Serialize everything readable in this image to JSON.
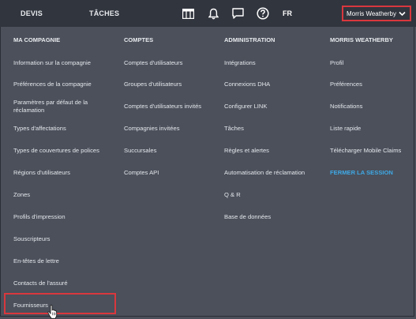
{
  "topbar": {
    "tabs": [
      "DEVIS",
      "TÂCHES"
    ],
    "icons": [
      "grid-icon",
      "bell-icon",
      "chat-icon",
      "help-icon",
      "chevron-down-icon"
    ],
    "language": "FR",
    "user_name": "Morris Weatherby"
  },
  "columns": [
    {
      "heading": "MA COMPAGNIE",
      "items": [
        "Information sur la compagnie",
        "Préférences de la compagnie",
        "Paramètres par défaut de la réclamation",
        "Types d'affectations",
        "Types de couvertures de polices",
        "Régions d'utilisateurs",
        "Zones",
        "Profils d'impression",
        "Souscripteurs",
        "En-têtes de lettre",
        "Contacts de l'assuré",
        "Fournisseurs"
      ]
    },
    {
      "heading": "COMPTES",
      "items": [
        "Comptes d'utilisateurs",
        "Groupes d'utilisateurs",
        "Comptes d'utilisateurs invités",
        "Compagnies invitées",
        "Succursales",
        "Comptes API"
      ]
    },
    {
      "heading": "ADMINISTRATION",
      "items": [
        "Intégrations",
        "Connexions DHA",
        "Configurer LINK",
        "Tâches",
        "Règles et alertes",
        "Automatisation de réclamation",
        "Q & R",
        "Base de données"
      ]
    },
    {
      "heading": "MORRIS WEATHERBY",
      "items": [
        "Profil",
        "Préférences",
        "Notifications",
        "Liste rapide",
        "Télécharger Mobile Claims",
        "FERMER LA SESSION"
      ]
    }
  ],
  "colors": {
    "background": "#4b505b",
    "topbar": "#31353e",
    "highlight": "#d9373d",
    "link_accent": "#3fa9e6"
  },
  "highlighted_item": "Fournisseurs"
}
